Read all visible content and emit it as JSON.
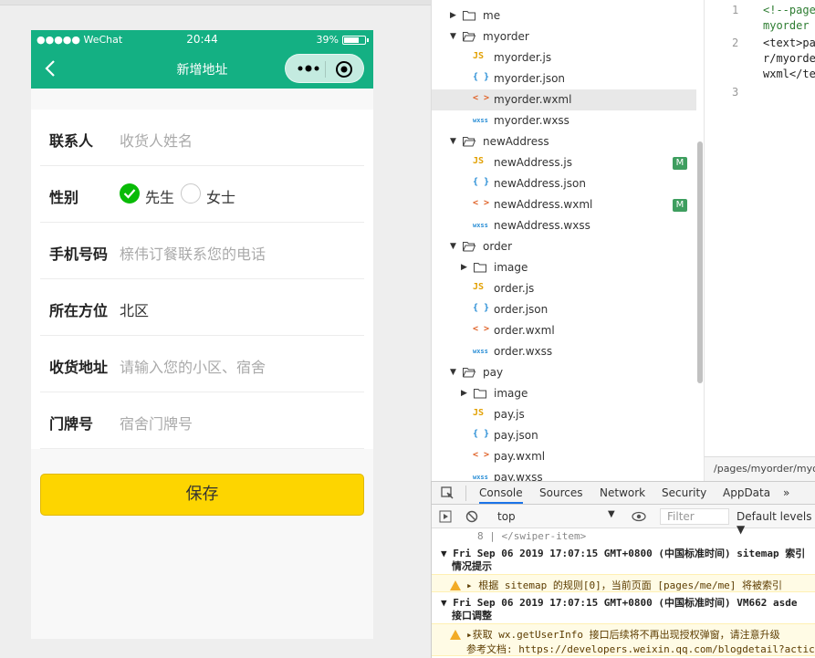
{
  "simulator": {
    "status": {
      "signal": "●●●●● WeChat",
      "time": "20:44",
      "battery": "39%"
    },
    "nav_title": "新增地址",
    "form": {
      "contact_label": "联系人",
      "contact_placeholder": "收货人姓名",
      "gender_label": "性别",
      "gender_male": "先生",
      "gender_female": "女士",
      "gender_selected": "先生",
      "phone_label": "手机号码",
      "phone_placeholder": "榇伟订餐联系您的电话",
      "location_label": "所在方位",
      "location_value": "北区",
      "address_label": "收货地址",
      "address_placeholder": "请输入您的小区、宿舍",
      "door_label": "门牌号",
      "door_placeholder": "宿舍门牌号"
    },
    "save_button": "保存",
    "colors": {
      "navbar": "#14b083",
      "save": "#fdd500",
      "radio_on": "#09bb07"
    }
  },
  "file_tree": {
    "items": [
      {
        "type": "folder",
        "name": "me",
        "level": 1,
        "expanded": false
      },
      {
        "type": "folder",
        "name": "myorder",
        "level": 1,
        "expanded": true
      },
      {
        "type": "js",
        "name": "myorder.js",
        "level": 2
      },
      {
        "type": "json",
        "name": "myorder.json",
        "level": 2
      },
      {
        "type": "wxml",
        "name": "myorder.wxml",
        "level": 2,
        "selected": true
      },
      {
        "type": "wxss",
        "name": "myorder.wxss",
        "level": 2
      },
      {
        "type": "folder",
        "name": "newAddress",
        "level": 1,
        "expanded": true
      },
      {
        "type": "js",
        "name": "newAddress.js",
        "level": 2,
        "badge": "M"
      },
      {
        "type": "json",
        "name": "newAddress.json",
        "level": 2
      },
      {
        "type": "wxml",
        "name": "newAddress.wxml",
        "level": 2,
        "badge": "M"
      },
      {
        "type": "wxss",
        "name": "newAddress.wxss",
        "level": 2
      },
      {
        "type": "folder",
        "name": "order",
        "level": 1,
        "expanded": true
      },
      {
        "type": "folder",
        "name": "image",
        "level": 2,
        "expanded": false
      },
      {
        "type": "js",
        "name": "order.js",
        "level": 2
      },
      {
        "type": "json",
        "name": "order.json",
        "level": 2
      },
      {
        "type": "wxml",
        "name": "order.wxml",
        "level": 2
      },
      {
        "type": "wxss",
        "name": "order.wxss",
        "level": 2
      },
      {
        "type": "folder",
        "name": "pay",
        "level": 1,
        "expanded": true
      },
      {
        "type": "folder",
        "name": "image",
        "level": 2,
        "expanded": false
      },
      {
        "type": "js",
        "name": "pay.js",
        "level": 2
      },
      {
        "type": "json",
        "name": "pay.json",
        "level": 2
      },
      {
        "type": "wxml",
        "name": "pay.wxml",
        "level": 2
      },
      {
        "type": "wxss",
        "name": "pay.wxss",
        "level": 2
      }
    ],
    "icon_glyphs": {
      "js": "JS",
      "json": "{ }",
      "wxml": "< >",
      "wxss": "wxss"
    }
  },
  "editor": {
    "lines": [
      {
        "num": "1",
        "text": [
          "<!--page",
          "myorder"
        ]
      },
      {
        "num": "2",
        "text": [
          "<text>pa",
          "r/myorde",
          "wxml</te"
        ]
      },
      {
        "num": "3",
        "text": [
          ""
        ]
      }
    ],
    "path": "/pages/myorder/myorder"
  },
  "devtools": {
    "tabs": [
      "Console",
      "Sources",
      "Network",
      "Security",
      "AppData",
      "»"
    ],
    "active_tab": "Console",
    "context": "top",
    "filter_placeholder": "Filter",
    "levels": "Default levels ▼",
    "console": [
      {
        "kind": "code",
        "text": "8 |        </swiper-item>"
      },
      {
        "kind": "group",
        "text": "▼ Fri Sep 06 2019 17:07:15 GMT+0800 (中国标准时间) sitemap 索引",
        "sub": "情况提示"
      },
      {
        "kind": "warn",
        "text": "▸ 根据 sitemap 的规则[0]，当前页面 [pages/me/me] 将被索引"
      },
      {
        "kind": "group",
        "text": "▼ Fri Sep 06 2019 17:07:15 GMT+0800 (中国标准时间)  VM662 asde",
        "sub": "接口调整"
      },
      {
        "kind": "warn",
        "text": "▸获取 wx.getUserInfo 接口后续将不再出现授权弹窗，请注意升级",
        "sub": "参考文档: https://developers.weixin.qq.com/blogdetail?actic"
      }
    ]
  }
}
